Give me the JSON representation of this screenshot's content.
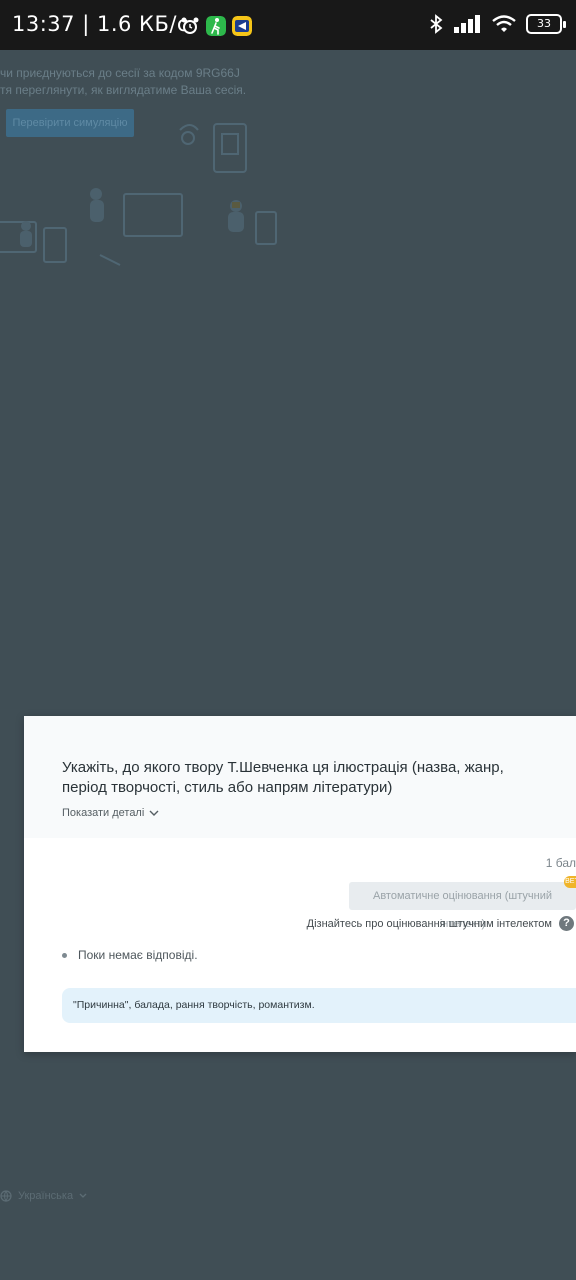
{
  "status_bar": {
    "time": "13:37",
    "speed": "1.6 КБ/с",
    "battery": "33"
  },
  "background": {
    "line1": "чи приєднуються до сесії за кодом 9RG66J",
    "line2": "тя переглянути, як виглядатиме Ваша сесія.",
    "button": "Перевірити симуляцію",
    "language": "Українська"
  },
  "question": {
    "title": "Укажіть, до якого твору Т.Шевченка ця ілюстрація (назва, жанр, період творчості, стиль або напрям літератури)",
    "show_details": "Показати деталі",
    "points": "1 бал",
    "ai_button": "Автоматичне оцінювання (штучний інтелект)",
    "beta_badge": "BETA",
    "learn_link": "Дізнайтесь про оцінювання штучним інтелектом",
    "help_icon": "?",
    "no_answer": "Поки немає відповіді.",
    "answer": "\"Причинна\", балада, рання творчість, романтизм."
  },
  "colors": {
    "overlay": "#404e55",
    "modal": "#ffffff",
    "answer_bg": "#e3f2fb",
    "beta": "#f0b429"
  }
}
